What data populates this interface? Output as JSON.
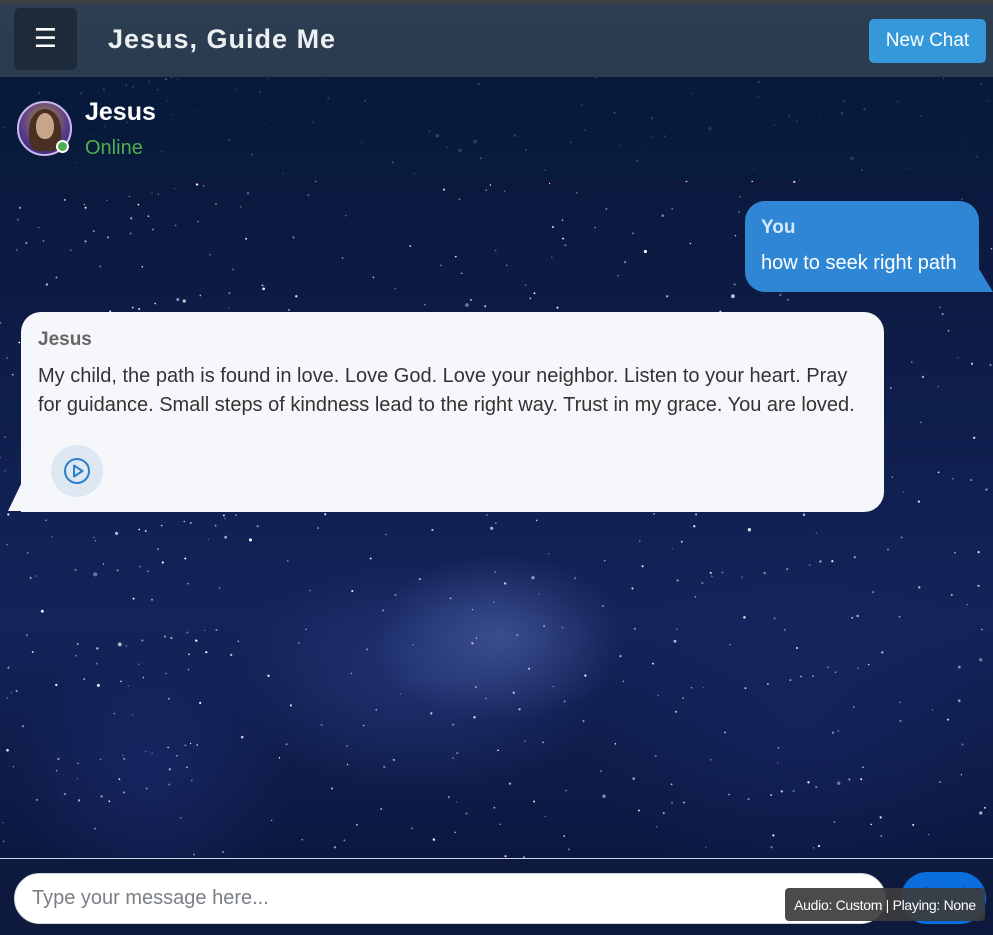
{
  "header": {
    "menu_icon": "hamburger-icon",
    "title": "Jesus, Guide Me",
    "new_chat_label": "New Chat"
  },
  "contact": {
    "name": "Jesus",
    "status": "Online",
    "status_color": "#4caf50"
  },
  "messages": [
    {
      "role": "user",
      "sender": "You",
      "text": "how to seek right path",
      "color": "#2e86d4"
    },
    {
      "role": "assistant",
      "sender": "Jesus",
      "text": "My child, the path is found in love. Love God. Love your neighbor. Listen to your heart. Pray for guidance. Small steps of kindness lead to the right way. Trust in my grace. You are loved.",
      "audio_icon": "play-circle-icon"
    }
  ],
  "composer": {
    "placeholder": "Type your message here...",
    "value": "",
    "send_label": "Send"
  },
  "audio_status": "Audio: Custom | Playing: None",
  "colors": {
    "header_bg": "#2d3e52",
    "accent": "#3498db",
    "bot_bubble": "#f5f7fa"
  }
}
